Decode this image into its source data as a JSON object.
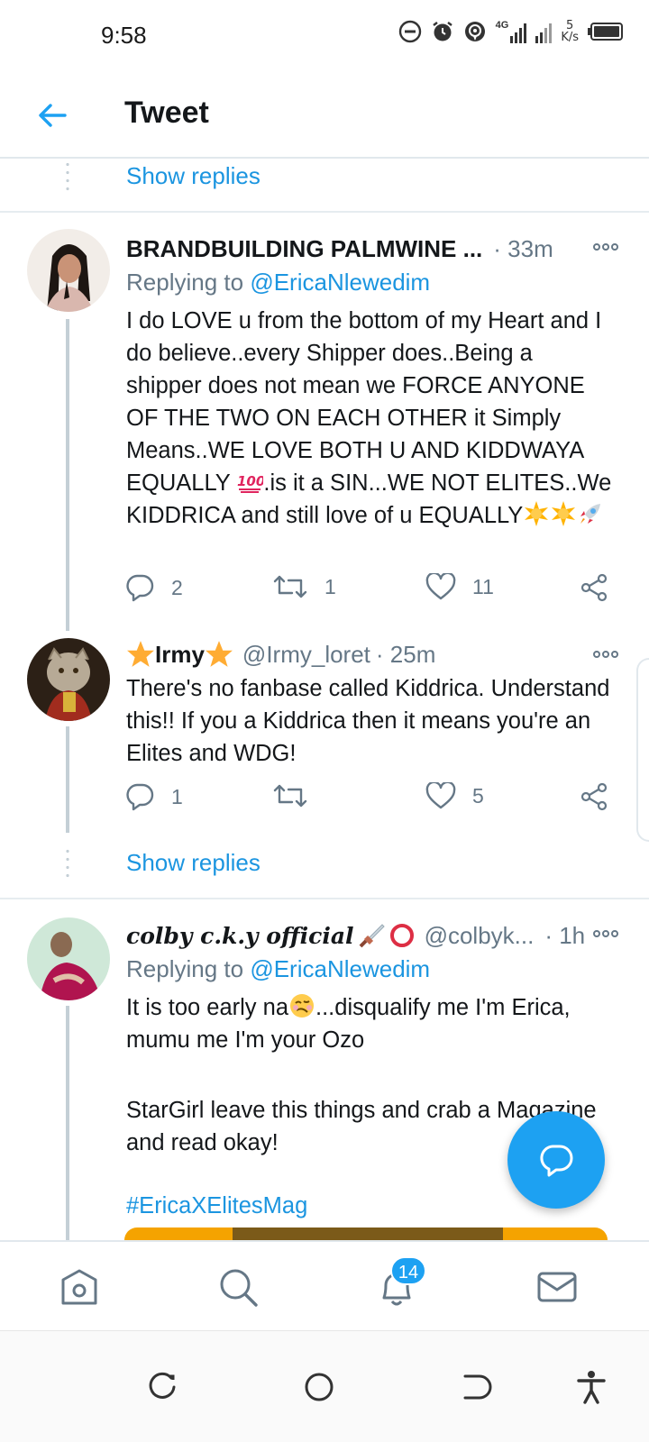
{
  "status_bar": {
    "time": "9:58",
    "network_type": "4G",
    "speed_value": "5",
    "speed_unit": "K/s"
  },
  "header": {
    "title": "Tweet"
  },
  "feed": {
    "show_replies_label": "Show replies",
    "tweets": [
      {
        "name": "BRANDBUILDING PALMWINE ...",
        "handle": "",
        "time": "· 33m",
        "replying_prefix": "Replying to ",
        "replying_to": "@EricaNlewedim",
        "body_parts": [
          "I do LOVE u from the bottom of my Heart and I do believe..every Shipper does..Being a shipper does not mean we FORCE ANYONE OF THE TWO ON EACH OTHER it Simply Means..WE LOVE BOTH U AND KIDDWAYA EQUALLY ",
          ".is it a SIN...WE NOT ELITES..We KIDDRICA and still love of u EQUALLY"
        ],
        "emojis": [
          "hundred-points",
          "sun",
          "sun",
          "rocket"
        ],
        "counts": {
          "replies": "2",
          "retweets": "1",
          "likes": "11"
        }
      },
      {
        "name": "Irmy",
        "handle": "@Irmy_loret",
        "time": "· 25m",
        "body": "There's no fanbase called Kiddrica. Understand this!! If you a Kiddrica then it means you're  an Elites  and WDG!",
        "emojis": [
          "star",
          "star"
        ],
        "counts": {
          "replies": "1",
          "retweets": "",
          "likes": "5"
        }
      },
      {
        "name": "colby c.k.y official",
        "handle": "@colbyk...",
        "time": "· 1h",
        "replying_prefix": "Replying to ",
        "replying_to": "@EricaNlewedim",
        "body_line1": "It is too early na",
        "body_line1_rest": "...disqualify me I'm Erica, mumu me I'm your Ozo",
        "body_para2": "StarGirl leave this things and crab a Magazine and read okay!",
        "hashtag": "#EricaXElitesMag",
        "emojis": [
          "dagger",
          "red-circle",
          "woozy-face"
        ]
      }
    ]
  },
  "tabbar": {
    "notifications_badge": "14",
    "tabs": [
      "home-icon",
      "search-icon",
      "notifications-icon",
      "messages-icon"
    ]
  },
  "colors": {
    "accent": "#1da1f2",
    "link": "#1b95e0",
    "text": "#14171a",
    "secondary_text": "#657786"
  }
}
